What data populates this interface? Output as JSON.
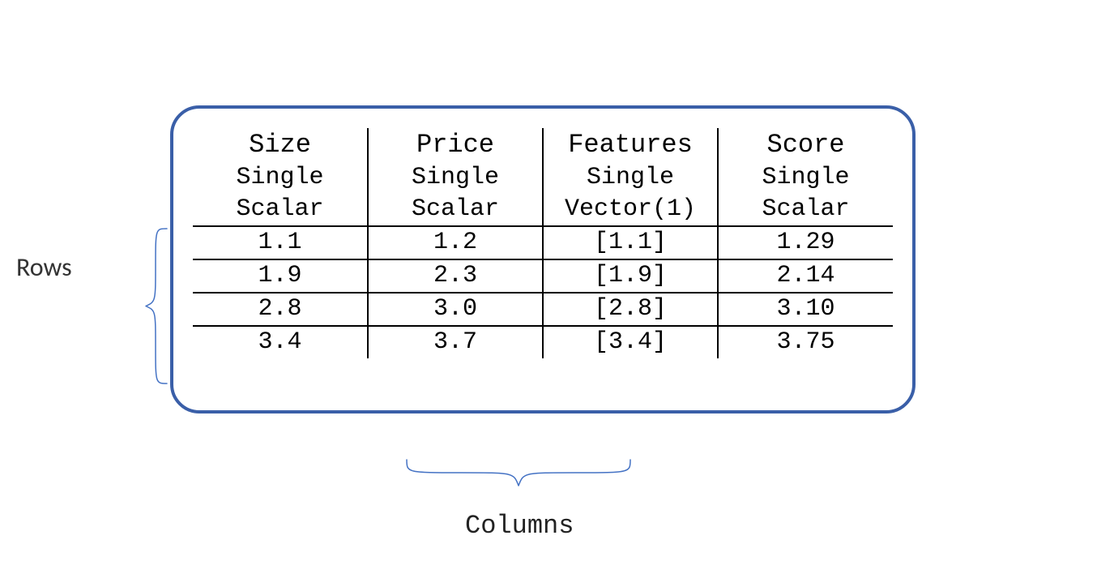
{
  "labels": {
    "rows": "Rows",
    "columns": "Columns"
  },
  "columns": [
    {
      "name": "Size",
      "sub1": "Single",
      "sub2": "Scalar"
    },
    {
      "name": "Price",
      "sub1": "Single",
      "sub2": "Scalar"
    },
    {
      "name": "Features",
      "sub1": "Single",
      "sub2": "Vector(1)"
    },
    {
      "name": "Score",
      "sub1": "Single",
      "sub2": "Scalar"
    }
  ],
  "rows": [
    [
      "1.1",
      "1.2",
      "[1.1]",
      "1.29"
    ],
    [
      "1.9",
      "2.3",
      "[1.9]",
      "2.14"
    ],
    [
      "2.8",
      "3.0",
      "[2.8]",
      "3.10"
    ],
    [
      "3.4",
      "3.7",
      "[3.4]",
      "3.75"
    ]
  ]
}
